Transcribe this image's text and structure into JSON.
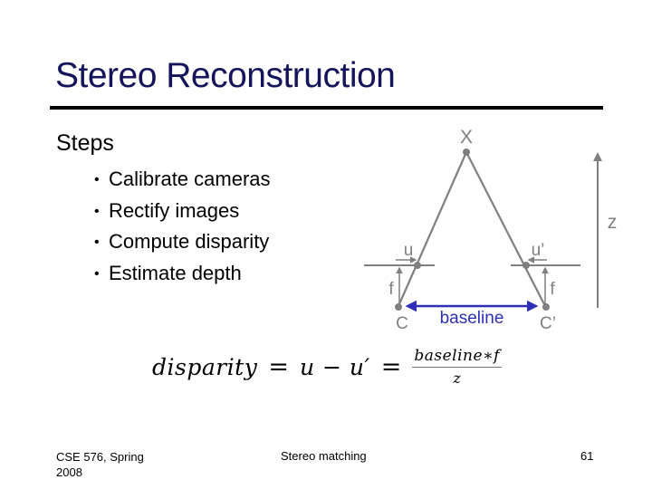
{
  "slide": {
    "title": "Stereo Reconstruction",
    "section_heading": "Steps",
    "bullet_glyph": "•",
    "bullets": [
      "Calibrate cameras",
      "Rectify images",
      "Compute disparity",
      "Estimate depth"
    ]
  },
  "diagram": {
    "labels": {
      "point": "X",
      "depth": "z",
      "left_image_coord": "u",
      "right_image_coord": "u’",
      "left_focal": "f",
      "right_focal": "f",
      "left_camera": "C",
      "right_camera": "C’",
      "baseline": "baseline"
    },
    "colors": {
      "lines": "#7f7f7f",
      "baseline": "#2e2eb8",
      "labels": "#808080"
    }
  },
  "formula": {
    "lhs": "disparity",
    "eq1": "=",
    "middle": "u − u′",
    "eq2": "=",
    "numerator": "baseline∗f",
    "denominator": "z"
  },
  "footer": {
    "left_line1": "CSE 576, Spring",
    "left_line2": "2008",
    "center": "Stereo matching",
    "page_number": "61"
  }
}
